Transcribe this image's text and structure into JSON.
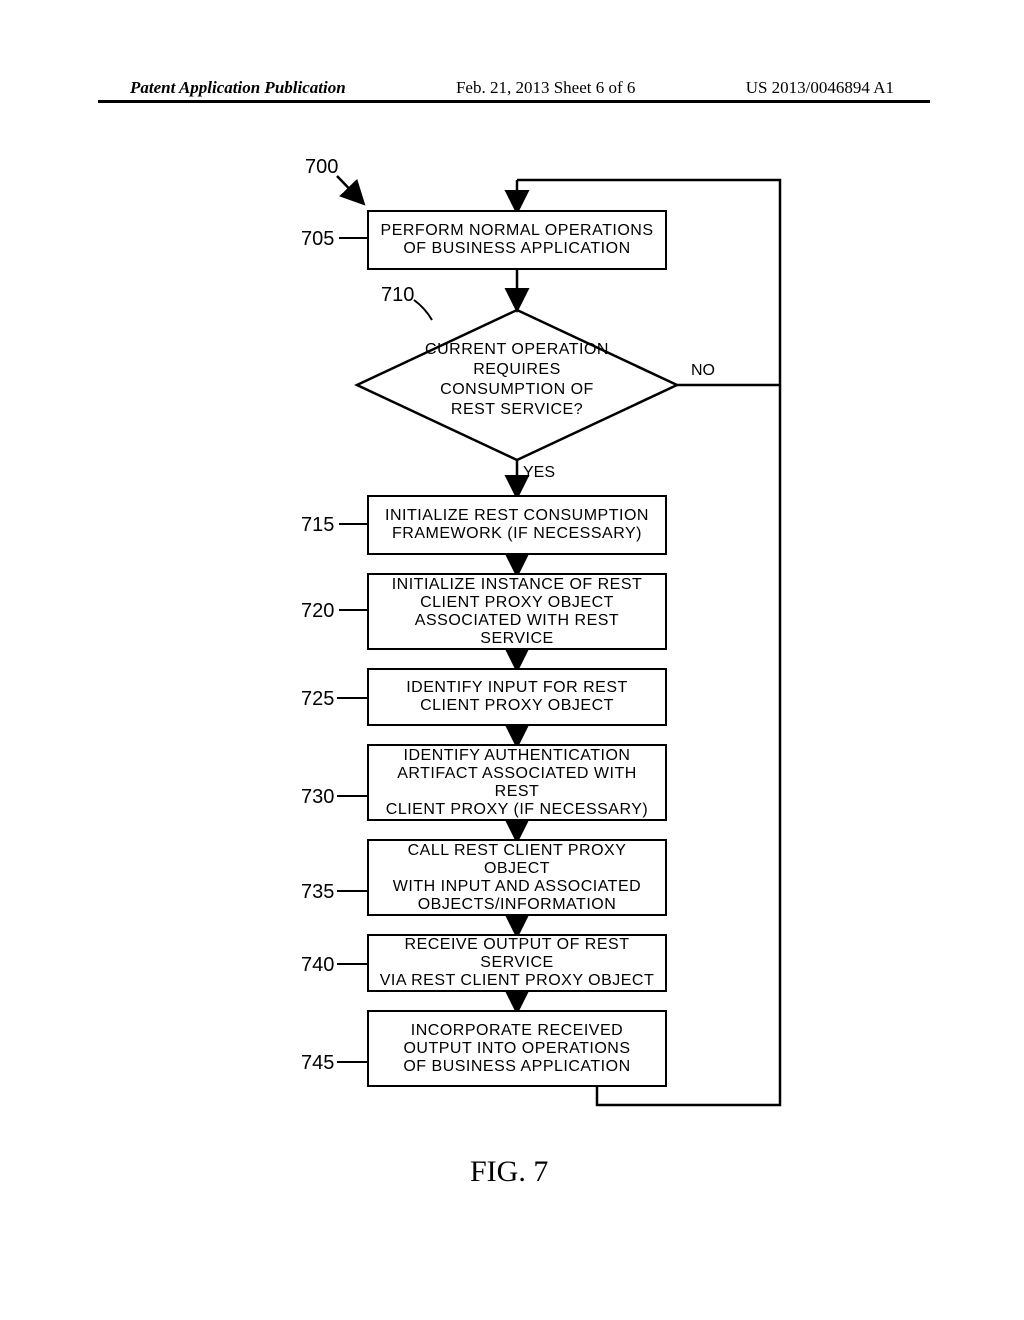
{
  "header": {
    "left": "Patent Application Publication",
    "mid": "Feb. 21, 2013  Sheet 6 of 6",
    "right": "US 2013/0046894 A1"
  },
  "figure_label": "FIG. 7",
  "flow_ref": "700",
  "steps": {
    "s705": {
      "num": "705",
      "text": "PERFORM NORMAL OPERATIONS\nOF BUSINESS APPLICATION"
    },
    "s710": {
      "num": "710",
      "text": "CURRENT\nOPERATION REQUIRES\nCONSUMPTION OF REST\nSERVICE?"
    },
    "s715": {
      "num": "715",
      "text": "INITIALIZE REST CONSUMPTION\nFRAMEWORK (IF NECESSARY)"
    },
    "s720": {
      "num": "720",
      "text": "INITIALIZE INSTANCE OF REST\nCLIENT PROXY OBJECT\nASSOCIATED WITH REST SERVICE"
    },
    "s725": {
      "num": "725",
      "text": "IDENTIFY INPUT FOR REST\nCLIENT PROXY OBJECT"
    },
    "s730": {
      "num": "730",
      "text": "IDENTIFY AUTHENTICATION\nARTIFACT ASSOCIATED WITH REST\nCLIENT PROXY (IF NECESSARY)"
    },
    "s735": {
      "num": "735",
      "text": "CALL REST CLIENT PROXY OBJECT\nWITH INPUT AND ASSOCIATED\nOBJECTS/INFORMATION"
    },
    "s740": {
      "num": "740",
      "text": "RECEIVE OUTPUT OF REST SERVICE\nVIA REST CLIENT PROXY OBJECT"
    },
    "s745": {
      "num": "745",
      "text": "INCORPORATE RECEIVED\nOUTPUT INTO OPERATIONS\nOF BUSINESS APPLICATION"
    }
  },
  "branches": {
    "yes": "YES",
    "no": "NO"
  }
}
